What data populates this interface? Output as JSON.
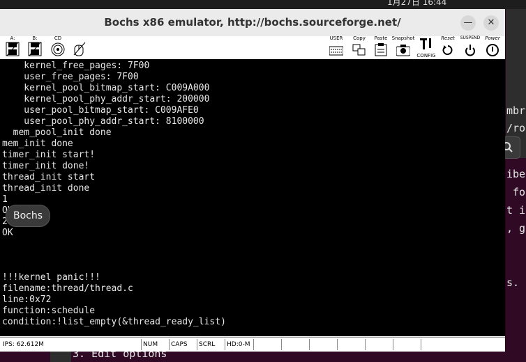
{
  "desktop": {
    "clock": "1月27日 16:44"
  },
  "background_terminal": {
    "lines": [
      "mbr",
      "/ro",
      "ibe",
      " fo",
      "t i",
      ", g",
      "s."
    ],
    "bottom_line": "3. Edit options"
  },
  "window": {
    "title": "Bochs x86 emulator, http://bochs.sourceforge.net/",
    "minimize_symbol": "—",
    "close_symbol": "✕"
  },
  "toolbar": {
    "floppy_a_label": "A:",
    "floppy_b_label": "B:",
    "cdrom_label": "CD",
    "user_label": "USER",
    "copy_label": "Copy",
    "paste_label": "Paste",
    "snapshot_label": "Snapshot",
    "config_label": "CONFIG",
    "reset_label": "Reset",
    "suspend_label": "SUSPEND",
    "power_label": "Power"
  },
  "console_lines": [
    "    kernel_free_pages: 7F00",
    "    user_free_pages: 7F00",
    "    kernel_pool_bitmap_start: C009A000",
    "    kernel_pool_phy_addr_start: 200000",
    "    user_pool_bitmap_start: C009AFE0",
    "    user_pool_phy_addr_start: 8100000",
    "  mem_pool_init done",
    "mem_init done",
    "timer_init start!",
    "timer_init done!",
    "thread_init start",
    "thread_init done",
    "1",
    "OK",
    "2",
    "OK",
    "",
    "",
    "",
    "!!!kernel panic!!!",
    "filename:thread/thread.c",
    "line:0x72",
    "function:schedule",
    "condition:!list_empty(&thread_ready_list)"
  ],
  "tooltip": "Bochs",
  "status_bar": {
    "ips": "IPS: 62.612M",
    "num": "NUM",
    "caps": "CAPS",
    "scrl": "SCRL",
    "hd": "HD:0-M"
  }
}
